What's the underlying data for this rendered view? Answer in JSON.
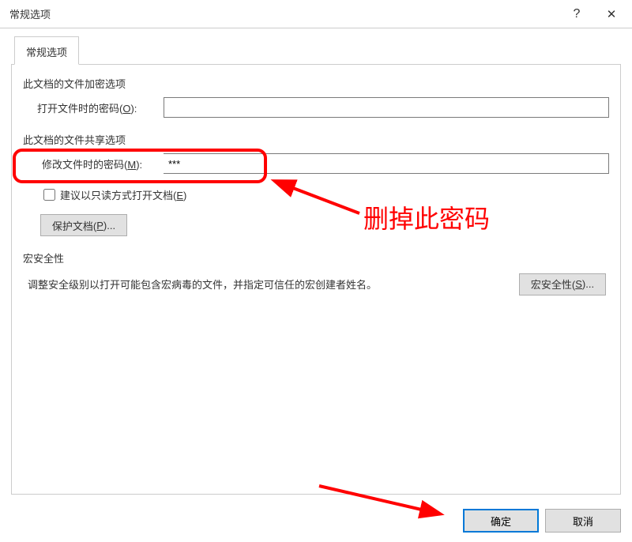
{
  "titlebar": {
    "title": "常规选项",
    "help": "?",
    "close": "✕"
  },
  "tab": {
    "label": "常规选项"
  },
  "encrypt": {
    "section_title": "此文档的文件加密选项",
    "open_pwd_label_pre": "打开文件时的密码(",
    "open_pwd_label_mn": "O",
    "open_pwd_label_post": "):",
    "open_pwd_value": ""
  },
  "share": {
    "section_title": "此文档的文件共享选项",
    "modify_pwd_label_pre": "修改文件时的密码(",
    "modify_pwd_label_mn": "M",
    "modify_pwd_label_post": "):",
    "modify_pwd_value": "***",
    "readonly_label_pre": "建议以只读方式打开文档(",
    "readonly_label_mn": "E",
    "readonly_label_post": ")",
    "protect_btn_pre": "保护文档(",
    "protect_btn_mn": "P",
    "protect_btn_post": ")..."
  },
  "macro": {
    "section_title": "宏安全性",
    "desc": "调整安全级别以打开可能包含宏病毒的文件，并指定可信任的宏创建者姓名。",
    "btn_pre": "宏安全性(",
    "btn_mn": "S",
    "btn_post": ")..."
  },
  "footer": {
    "ok": "确定",
    "cancel": "取消"
  },
  "annotation": {
    "text1": "删掉此密码"
  }
}
